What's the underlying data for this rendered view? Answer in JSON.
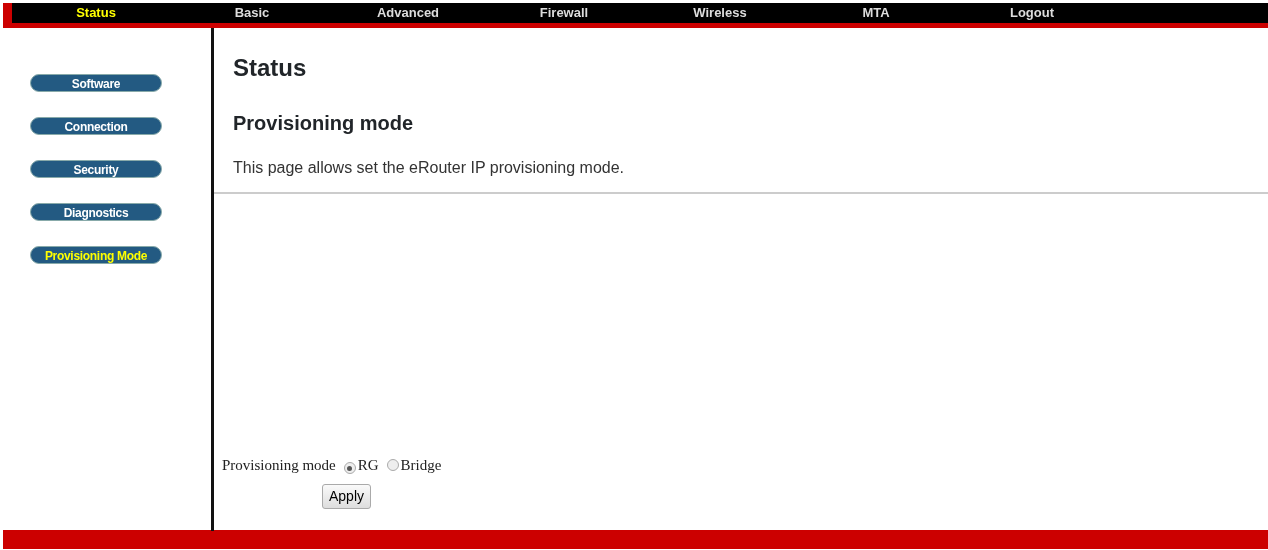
{
  "top_nav": [
    {
      "label": "Status",
      "selected": true
    },
    {
      "label": "Basic",
      "selected": false
    },
    {
      "label": "Advanced",
      "selected": false
    },
    {
      "label": "Firewall",
      "selected": false
    },
    {
      "label": "Wireless",
      "selected": false
    },
    {
      "label": "MTA",
      "selected": false
    },
    {
      "label": "Logout",
      "selected": false
    }
  ],
  "sidebar": {
    "items": [
      {
        "label": "Software",
        "selected": false
      },
      {
        "label": "Connection",
        "selected": false
      },
      {
        "label": "Security",
        "selected": false
      },
      {
        "label": "Diagnostics",
        "selected": false
      },
      {
        "label": "Provisioning Mode",
        "selected": true
      }
    ]
  },
  "page_title": "Status",
  "section_title": "Provisioning mode",
  "description": "This page allows set the eRouter IP provisioning mode.",
  "form": {
    "label": "Provisioning mode",
    "options": [
      {
        "label": "RG",
        "selected": true
      },
      {
        "label": "Bridge",
        "selected": false
      }
    ],
    "button": "Apply"
  }
}
